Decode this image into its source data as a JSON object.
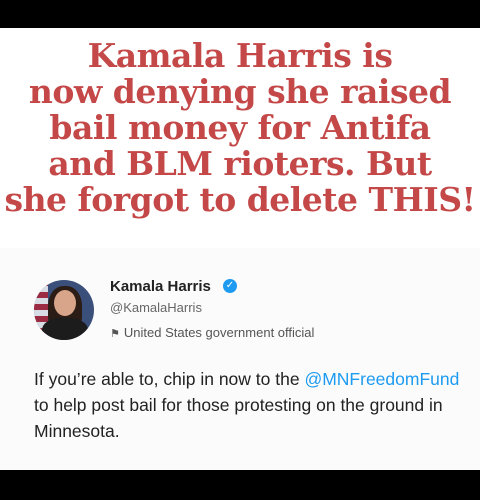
{
  "headline": {
    "lines": [
      "Kamala Harris is",
      "now denying she raised",
      "bail money for Antifa",
      "and BLM rioters. But",
      "she forgot to delete THIS!"
    ]
  },
  "tweet": {
    "author_name": "Kamala Harris",
    "handle": "@KamalaHarris",
    "label": "United States government official",
    "text_before": "If you’re able to, chip in now to the",
    "mention": "@MNFreedomFund",
    "text_after": "to help post bail for those protesting on the ground in Minnesota."
  },
  "icons": {
    "verified": "verified-badge-icon",
    "label": "flag-icon"
  },
  "colors": {
    "headline": "#c44848",
    "mention": "#1d9bf0",
    "verified": "#1d9bf0"
  }
}
